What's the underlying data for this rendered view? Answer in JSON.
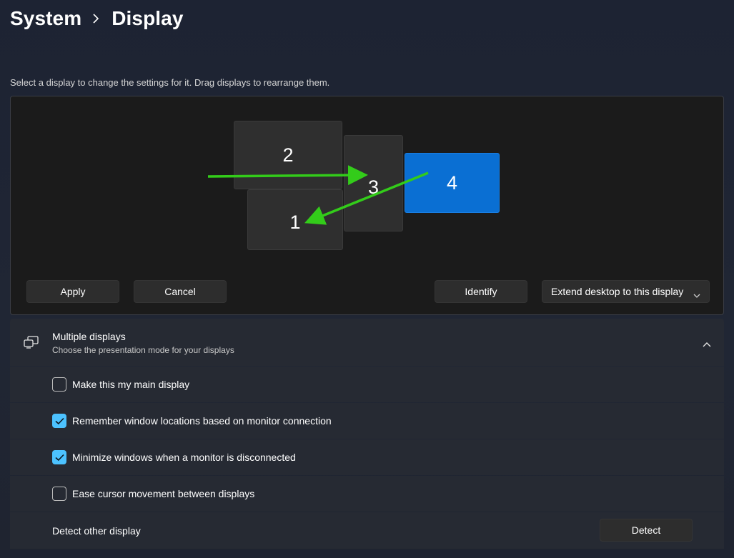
{
  "breadcrumb": {
    "parent": "System",
    "current": "Display"
  },
  "hint": "Select a display to change the settings for it. Drag displays to rearrange them.",
  "monitors": [
    {
      "label": "2"
    },
    {
      "label": "3"
    },
    {
      "label": "1"
    },
    {
      "label": "4",
      "selected": true
    }
  ],
  "buttons": {
    "apply": "Apply",
    "cancel": "Cancel",
    "identify": "Identify",
    "extend": "Extend desktop to this display"
  },
  "multiple_displays": {
    "title": "Multiple displays",
    "subtitle": "Choose the presentation mode for your displays",
    "options": [
      {
        "label": "Make this my main display",
        "checked": false
      },
      {
        "label": "Remember window locations based on monitor connection",
        "checked": true
      },
      {
        "label": "Minimize windows when a monitor is disconnected",
        "checked": true
      },
      {
        "label": "Ease cursor movement between displays",
        "checked": false
      }
    ],
    "detect_label": "Detect other display",
    "detect_button": "Detect"
  },
  "colors": {
    "accent": "#0a6fd3",
    "checkbox_checked": "#4cc2ff",
    "annotation_arrow": "#33cc1a"
  }
}
